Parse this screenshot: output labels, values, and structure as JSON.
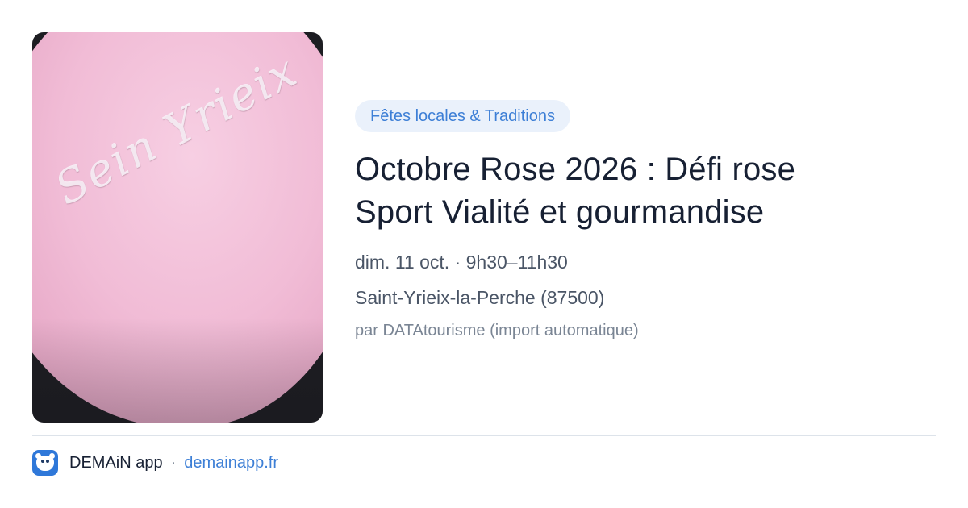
{
  "image": {
    "alt_text": "Sein Yrieix"
  },
  "event": {
    "category": "Fêtes locales & Traditions",
    "title_line1": "Octobre Rose 2026 : Défi rose",
    "title_line2": "Sport Vialité et gourmandise",
    "datetime": "dim. 11 oct. · 9h30–11h30",
    "location": "Saint-Yrieix-la-Perche (87500)",
    "source": "par DATAtourisme (import automatique)"
  },
  "footer": {
    "app_name": "DEMAiN app",
    "separator": "·",
    "link": "demainapp.fr",
    "logo_icon": "bear-face-icon"
  },
  "colors": {
    "accent": "#3d7fd6",
    "tag_background": "#eaf1fb",
    "title": "#172033",
    "muted": "#4a5566",
    "logo": "#2f78d9"
  }
}
